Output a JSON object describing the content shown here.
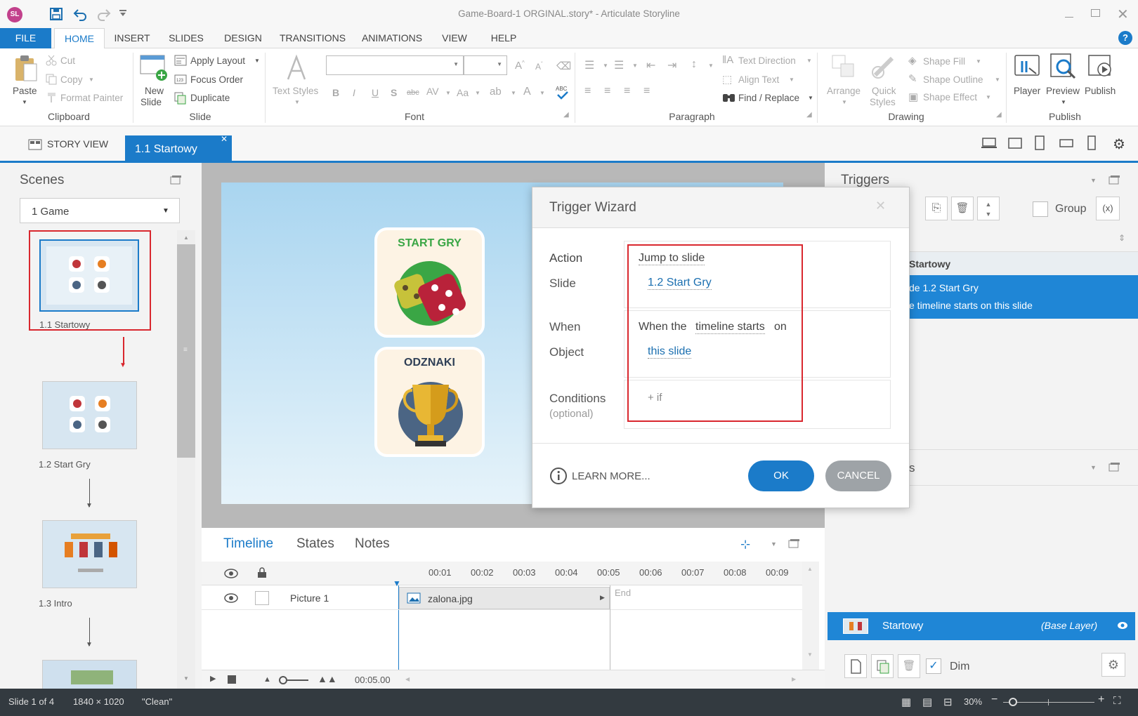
{
  "window": {
    "title": "Game-Board-1 ORGINAL.story* - Articulate Storyline",
    "app_icon": "SL"
  },
  "ribbon_tabs": [
    "FILE",
    "HOME",
    "INSERT",
    "SLIDES",
    "DESIGN",
    "TRANSITIONS",
    "ANIMATIONS",
    "VIEW",
    "HELP"
  ],
  "ribbon": {
    "clipboard": {
      "paste": "Paste",
      "cut": "Cut",
      "copy": "Copy",
      "format_painter": "Format Painter",
      "label": "Clipboard"
    },
    "slide": {
      "new_slide_1": "New",
      "new_slide_2": "Slide",
      "apply_layout": "Apply Layout",
      "focus_order": "Focus Order",
      "duplicate": "Duplicate",
      "label": "Slide"
    },
    "font": {
      "text_styles_1": "Text Styles",
      "label": "Font"
    },
    "paragraph": {
      "text_direction": "Text Direction",
      "align_text": "Align Text",
      "find_replace": "Find / Replace",
      "label": "Paragraph"
    },
    "drawing": {
      "arrange": "Arrange",
      "quick_styles_1": "Quick",
      "quick_styles_2": "Styles",
      "shape_fill": "Shape Fill",
      "shape_outline": "Shape Outline",
      "shape_effect": "Shape Effect",
      "label": "Drawing"
    },
    "publish": {
      "player": "Player",
      "preview": "Preview",
      "publish": "Publish",
      "label": "Publish"
    }
  },
  "view_tabs": {
    "story_view": "STORY VIEW",
    "slide_tab": "1.1 Startowy"
  },
  "scenes": {
    "title": "Scenes",
    "selected_scene": "1 Game",
    "slides": [
      "1.1 Startowy",
      "1.2 Start Gry",
      "1.3 Intro"
    ]
  },
  "canvas": {
    "card1_title": "START GRY",
    "card2_title": "ODZNAKI"
  },
  "dialog": {
    "title": "Trigger Wizard",
    "action_label": "Action",
    "action_value": "Jump to slide",
    "slide_label": "Slide",
    "slide_value": "1.2 Start Gry",
    "when_label": "When",
    "when_prefix": "When the",
    "when_link": "timeline starts",
    "when_suffix": "on",
    "object_label": "Object",
    "object_value": "this slide",
    "conditions_label": "Conditions",
    "conditions_optional": "(optional)",
    "add_if": "+ if",
    "learn_more": "LEARN MORE...",
    "ok": "OK",
    "cancel": "CANCEL"
  },
  "triggers": {
    "title": "Triggers",
    "group_label": "Group",
    "slide_group": "Startowy",
    "trigger_line1": "de 1.2 Start Gry",
    "trigger_line2": "e timeline starts on this slide",
    "layers_title": "s",
    "base_layer_name": "Startowy",
    "base_layer_tag": "(Base Layer)",
    "dim_label": "Dim"
  },
  "timeline": {
    "tabs": [
      "Timeline",
      "States",
      "Notes"
    ],
    "ticks": [
      "00:01",
      "00:02",
      "00:03",
      "00:04",
      "00:05",
      "00:06",
      "00:07",
      "00:08",
      "00:09"
    ],
    "row_name": "Picture 1",
    "row_file": "zalona.jpg",
    "end_label": "End",
    "duration": "00:05.00"
  },
  "status": {
    "slide": "Slide 1 of 4",
    "size": "1840 × 1020",
    "theme": "\"Clean\"",
    "zoom": "30%"
  },
  "colors": {
    "accent": "#1b7bc9",
    "highlight_box": "#d9272e",
    "selection": "#1f86d6"
  }
}
